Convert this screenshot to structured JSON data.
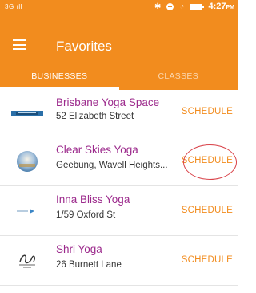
{
  "status_bar": {
    "signal": "3G",
    "bars": "ıll",
    "time": "4:27",
    "time_suffix": "PM"
  },
  "app_bar": {
    "title": "Favorites"
  },
  "tabs": [
    {
      "label": "BUSINESSES",
      "active": true
    },
    {
      "label": "CLASSES",
      "active": false
    }
  ],
  "businesses": [
    {
      "name": "Brisbane Yoga Space",
      "address": "52 Elizabeth Street",
      "action": "SCHEDULE",
      "logo": "brisbane-yoga-space-logo"
    },
    {
      "name": "Clear Skies Yoga",
      "address": "Geebung, Wavell Heights...",
      "action": "SCHEDULE",
      "logo": "clear-skies-yoga-logo",
      "annotated": true
    },
    {
      "name": "Inna Bliss Yoga",
      "address": "1/59 Oxford St",
      "action": "SCHEDULE",
      "logo": "inna-bliss-yoga-logo"
    },
    {
      "name": "Shri Yoga",
      "address": "26 Burnett Lane",
      "action": "SCHEDULE",
      "logo": "shri-yoga-logo"
    }
  ],
  "colors": {
    "primary": "#f28c1e",
    "name_text": "#9c2a8c",
    "annotation": "#d9434a"
  }
}
